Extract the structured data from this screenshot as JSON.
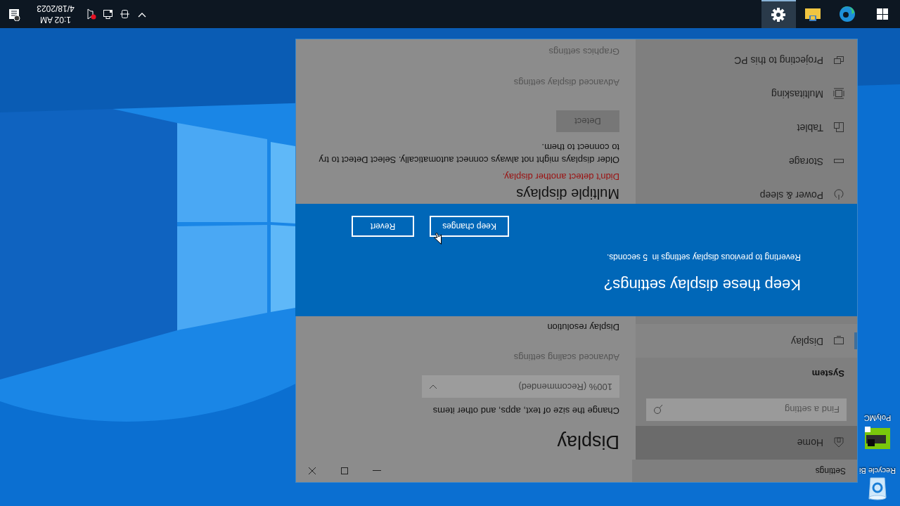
{
  "desktop_icons": [
    {
      "kind": "recycle-bin",
      "label": "Recycle Bi"
    },
    {
      "kind": "app",
      "label": "PolyMC"
    }
  ],
  "window": {
    "title": "Settings"
  },
  "sidebar": {
    "home": {
      "label": "Home",
      "highlighted": true
    },
    "search": {
      "placeholder": "Find a setting"
    },
    "section": "System",
    "items": [
      {
        "kind": "display",
        "label": "Display",
        "selected": true
      },
      {
        "kind": "power",
        "label": "Power & sleep",
        "selected": false
      },
      {
        "kind": "storage",
        "label": "Storage",
        "selected": false
      },
      {
        "kind": "tablet",
        "label": "Tablet",
        "selected": false
      },
      {
        "kind": "multitasking",
        "label": "Multitasking",
        "selected": false
      },
      {
        "kind": "projecting",
        "label": "Projecting to this PC",
        "selected": false
      }
    ]
  },
  "content": {
    "title": "Display",
    "scale_label": "Change the size of text, apps, and other items",
    "scale_value": "100% (Recommended)",
    "advanced_scaling": "Advanced scaling settings",
    "resolution_label": "Display resolution",
    "multiple_heading": "Multiple displays",
    "error": "Didn't detect another display.",
    "description": "Older displays might not always connect automatically. Select Detect to try to connect to them.",
    "detect_button": "Detect",
    "advanced_display": "Advanced display settings",
    "graphics": "Graphics settings"
  },
  "dialog": {
    "title": "Keep these display settings?",
    "message": "Reverting to previous display settings in  5 seconds.",
    "buttons": [
      "Keep changes",
      "Revert"
    ]
  },
  "taskbar": {
    "apps": [
      {
        "kind": "browser",
        "selected": false
      },
      {
        "kind": "folder",
        "selected": false
      },
      {
        "kind": "settings",
        "selected": true
      }
    ],
    "tray": {
      "time": "1:02 AM",
      "date": "4/18/2023"
    }
  }
}
